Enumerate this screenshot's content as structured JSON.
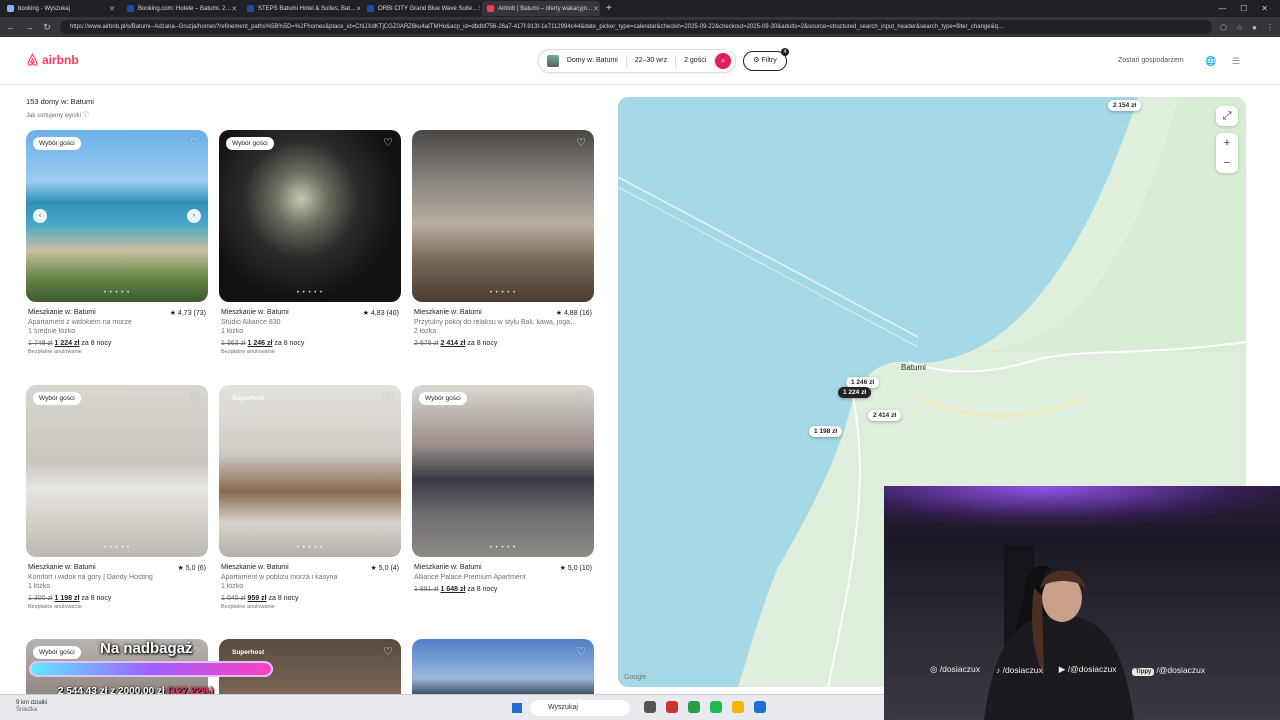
{
  "browser": {
    "tabs": [
      {
        "label": "booking - Wyszukaj",
        "color": "#8ab4f8",
        "active": false
      },
      {
        "label": "Booking.com: Hotele – Batumi. 2…",
        "color": "#1a4fa3",
        "active": false
      },
      {
        "label": "STEPS Batumi Hotel & Suites, Bat…",
        "color": "#1a4fa3",
        "active": false
      },
      {
        "label": "ORBI CITY Grand Blue Wave Suite…",
        "color": "#1a4fa3",
        "active": false
      },
      {
        "label": "Airbnb | Batumi – oferty wakacyjn…",
        "color": "#ff385c",
        "active": true
      }
    ],
    "url": "https://www.airbnb.pl/s/Batumi--Adżaria--Gruzja/homes?refinement_paths%5B%5D=%2Fhomes&place_id=ChIJXdKTjCGZ0ARZ6ku4aITMHo&acp_id=dbdbf756-26a7-417f-913f-1e7112994c44&date_picker_type=calendar&checkin=2025-09-22&checkout=2025-09-30&adults=2&source=structured_search_input_header&search_type=filter_change&q…"
  },
  "header": {
    "logo": "airbnb",
    "search": {
      "place": "Domy w: Batumi",
      "dates": "22–30 wrz",
      "guests": "2 gości"
    },
    "filters_label": "Filtry",
    "filters_count": "4",
    "host_link": "Zostań gospodarzem"
  },
  "results": {
    "count": "153 domy w: Batumi",
    "sort_info": "Jak sortujemy wyniki ⓘ"
  },
  "listings": [
    {
      "badge": "Wybór gości",
      "type": "Mieszkanie w: Batumi",
      "rating": "★ 4,73 (73)",
      "title": "Apartament z widokiem na morze",
      "beds": "1 średnie łóżko",
      "old_price": "1 748 zł",
      "new_price": "1 224 zł",
      "period": "za 8 nocy",
      "cancel": "Bezpłatne anulowanie"
    },
    {
      "badge": "Wybór gości",
      "type": "Mieszkanie w: Batumi",
      "rating": "★ 4,83 (40)",
      "title": "Studio Alliance 830",
      "beds": "1 łóżko",
      "old_price": "1 363 zł",
      "new_price": "1 246 zł",
      "period": "za 8 nocy",
      "cancel": "Bezpłatne anulowanie"
    },
    {
      "badge": "",
      "type": "Mieszkanie w: Batumi",
      "rating": "★ 4,88 (16)",
      "title": "Przytulny pokój do relaksu w stylu Bali, kawa, joga…",
      "beds": "2 łóżka",
      "old_price": "2 676 zł",
      "new_price": "2 414 zł",
      "period": "za 8 nocy",
      "cancel": ""
    },
    {
      "badge": "Wybór gości",
      "type": "Mieszkanie w: Batumi",
      "rating": "★ 5,0 (6)",
      "title": "Komfort i widok na góry | Dandy Hosting",
      "beds": "1 łóżko",
      "old_price": "1 300 zł",
      "new_price": "1 198 zł",
      "period": "za 8 nocy",
      "cancel": "Bezpłatne anulowanie"
    },
    {
      "badge": "Superhost",
      "type": "Mieszkanie w: Batumi",
      "rating": "★ 5,0 (4)",
      "title": "Apartament w pobliżu morza i kasyna",
      "beds": "1 łóżko",
      "old_price": "1 040 zł",
      "new_price": "959 zł",
      "period": "za 8 nocy",
      "cancel": "Bezpłatne anulowanie"
    },
    {
      "badge": "Wybór gości",
      "type": "Mieszkanie w: Batumi",
      "rating": "★ 5,0 (10)",
      "title": "Alliance Palace Premium Apartment",
      "beds": "",
      "old_price": "1 881 zł",
      "new_price": "1 648 zł",
      "period": "za 8 nocy",
      "cancel": ""
    },
    {
      "badge": "Wybór gości",
      "type": "",
      "rating": "",
      "title": "",
      "beds": "",
      "old_price": "",
      "new_price": "",
      "period": "",
      "cancel": ""
    },
    {
      "badge": "Superhost",
      "type": "",
      "rating": "",
      "title": "",
      "beds": "",
      "old_price": "",
      "new_price": "",
      "period": "",
      "cancel": ""
    },
    {
      "badge": "",
      "type": "",
      "rating": "",
      "title": "",
      "beds": "",
      "old_price": "",
      "new_price": "",
      "period": "",
      "cancel": ""
    }
  ],
  "map": {
    "pins": [
      {
        "label": "2 154 zł",
        "dark": false
      },
      {
        "label": "1 246 zł",
        "dark": false
      },
      {
        "label": "1 224 zł",
        "dark": true
      },
      {
        "label": "2 414 zł",
        "dark": false
      },
      {
        "label": "1 198 zł",
        "dark": false
      }
    ],
    "city_label": "Batumi",
    "google": "Google"
  },
  "stream": {
    "goal_title": "Na nadbagaż",
    "goal_progress": 1.0,
    "goal_amount": "2 544,43 zł z 2000,00 zł",
    "goal_percent": "(127,22%)",
    "socials": [
      {
        "tag": "",
        "label": "/dosiaczux"
      },
      {
        "tag": "",
        "label": "/dosiaczux"
      },
      {
        "tag": "",
        "label": "/@dosiaczux"
      },
      {
        "tag": "Tippy",
        "label": "/@dosiaczux"
      }
    ]
  },
  "taskbar": {
    "weather_temp": "9 km działki",
    "weather_sub": "Śnieżka",
    "search_label": "Wyszukaj"
  }
}
